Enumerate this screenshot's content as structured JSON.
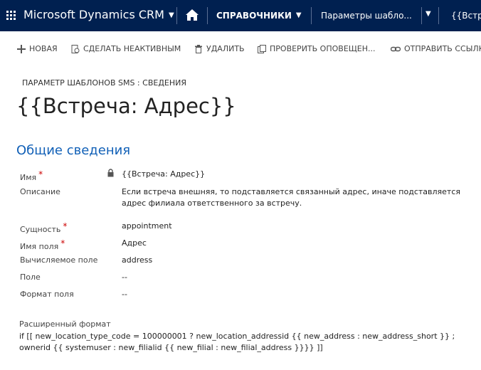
{
  "topnav": {
    "brand": "Microsoft Dynamics CRM",
    "section": "СПРАВОЧНИКИ",
    "entity_nav": "Параметры шабло...",
    "record_nav": "{{Встре"
  },
  "commands": {
    "new": "НОВАЯ",
    "deactivate": "СДЕЛАТЬ НЕАКТИВНЫМ",
    "delete": "УДАЛИТЬ",
    "check": "ПРОВЕРИТЬ ОПОВЕЩЕН...",
    "send": "ОТПРАВИТЬ ССЫЛК"
  },
  "header": {
    "breadcrumb": "ПАРАМЕТР ШАБЛОНОВ SMS : СВЕДЕНИЯ",
    "title": "{{Встреча: Адрес}}"
  },
  "section_title": "Общие сведения",
  "fields": {
    "name_label": "Имя",
    "name_value": "{{Встреча: Адрес}}",
    "description_label": "Описание",
    "description_value": "Если встреча внешняя, то подставляется связанный адрес, иначе подставляется адрес филиала ответственного за встречу.",
    "entity_label": "Сущность",
    "entity_value": "appointment",
    "field_name_label": "Имя поля",
    "field_name_value": "Адрес",
    "computed_label": "Вычисляемое поле",
    "computed_value": "address",
    "field_label": "Поле",
    "field_value": "--",
    "format_label": "Формат поля",
    "format_value": "--",
    "required_mark": "*"
  },
  "extended": {
    "label": "Расширенный формат",
    "value": "if [[ new_location_type_code = 100000001 ? new_location_addressid {{ new_address : new_address_short }} ; ownerid {{ systemuser : new_filialid {{ new_filial : new_filial_address }}}} ]]"
  },
  "colors": {
    "topbar": "#002050",
    "section_title": "#1160b7",
    "required": "#cc0000"
  },
  "icons": [
    "grid-icon",
    "chevron-down-icon",
    "home-icon",
    "plus-icon",
    "deactivate-icon",
    "trash-icon",
    "check-icon",
    "link-icon",
    "lock-icon"
  ]
}
